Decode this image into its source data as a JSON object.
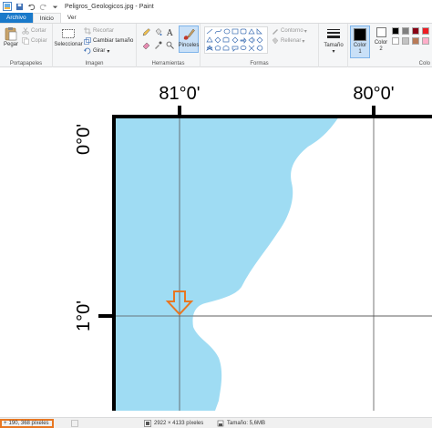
{
  "window": {
    "title": "Peligros_Geologicos.jpg - Paint"
  },
  "tabs": [
    "Archivo",
    "Inicio",
    "Ver"
  ],
  "ribbon": {
    "clipboard": {
      "paste": "Pegar",
      "cut": "Cortar",
      "copy": "Copiar",
      "label": "Portapapeles"
    },
    "image": {
      "select": "Seleccionar",
      "crop": "Recortar",
      "resize": "Cambiar tamaño",
      "rotate": "Girar",
      "label": "Imagen"
    },
    "tools": {
      "brushes": "Pinceles",
      "label": "Herramientas"
    },
    "shapes": {
      "outline": "Contorno",
      "fill": "Rellenar",
      "label": "Formas"
    },
    "size": {
      "label": "Tamaño"
    },
    "colors": {
      "color1": "Color 1",
      "color2": "Color 2",
      "label": "Colo",
      "color1_value": "#000000",
      "color2_value": "#ffffff",
      "palette": [
        "#000000",
        "#7f7f7f",
        "#880015",
        "#ed1c24",
        "#ffffff",
        "#c3c3c3",
        "#b97a57",
        "#ffaec9"
      ]
    }
  },
  "map": {
    "lon_labels": [
      "81°0'",
      "80°0'"
    ],
    "lat_labels": [
      "0°0'",
      "1°0'"
    ],
    "water_color": "#9fdcf3",
    "marker_color": "#e87722"
  },
  "statusbar": {
    "cursor": "190, 368 píxeles",
    "dimensions": "2922 × 4133 píxeles",
    "size": "Tamaño: 5,6MB"
  }
}
